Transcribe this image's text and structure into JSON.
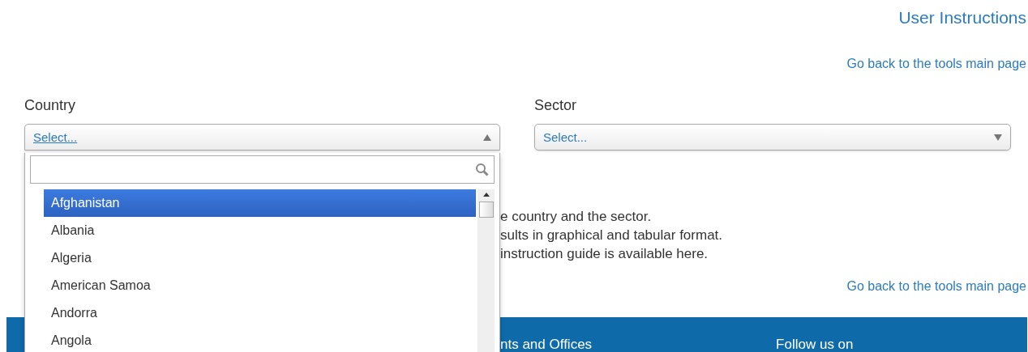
{
  "header": {
    "title": "User Instructions",
    "back_link": "Go back to the tools main page"
  },
  "filters": [
    {
      "label": "Country",
      "value": "Select...",
      "expanded": true
    },
    {
      "label": "Sector",
      "value": "Select...",
      "expanded": false
    }
  ],
  "dropdown": {
    "options": [
      {
        "label": "Afghanistan",
        "selected": true
      },
      {
        "label": "Albania",
        "selected": false
      },
      {
        "label": "Algeria",
        "selected": false
      },
      {
        "label": "American Samoa",
        "selected": false
      },
      {
        "label": "Andorra",
        "selected": false
      },
      {
        "label": "Angola",
        "selected": false
      }
    ]
  },
  "instructions": [
    "e country and the sector.",
    "sults in graphical and tabular format.",
    "instruction guide is available here."
  ],
  "bottom_link": "Go back to the tools main page",
  "footer": {
    "column_1": "nts and Offices",
    "column_2": "Follow us on"
  }
}
